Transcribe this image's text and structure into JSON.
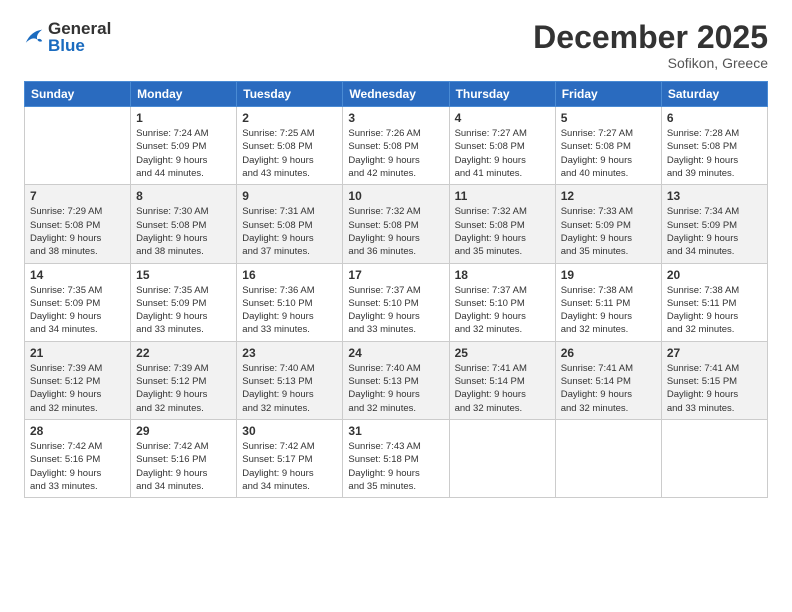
{
  "header": {
    "logo": {
      "general": "General",
      "blue": "Blue"
    },
    "title": "December 2025",
    "subtitle": "Sofikon, Greece"
  },
  "weekdays": [
    "Sunday",
    "Monday",
    "Tuesday",
    "Wednesday",
    "Thursday",
    "Friday",
    "Saturday"
  ],
  "weeks": [
    {
      "alt": false,
      "days": [
        {
          "num": "",
          "info": ""
        },
        {
          "num": "1",
          "info": "Sunrise: 7:24 AM\nSunset: 5:09 PM\nDaylight: 9 hours\nand 44 minutes."
        },
        {
          "num": "2",
          "info": "Sunrise: 7:25 AM\nSunset: 5:08 PM\nDaylight: 9 hours\nand 43 minutes."
        },
        {
          "num": "3",
          "info": "Sunrise: 7:26 AM\nSunset: 5:08 PM\nDaylight: 9 hours\nand 42 minutes."
        },
        {
          "num": "4",
          "info": "Sunrise: 7:27 AM\nSunset: 5:08 PM\nDaylight: 9 hours\nand 41 minutes."
        },
        {
          "num": "5",
          "info": "Sunrise: 7:27 AM\nSunset: 5:08 PM\nDaylight: 9 hours\nand 40 minutes."
        },
        {
          "num": "6",
          "info": "Sunrise: 7:28 AM\nSunset: 5:08 PM\nDaylight: 9 hours\nand 39 minutes."
        }
      ]
    },
    {
      "alt": true,
      "days": [
        {
          "num": "7",
          "info": "Sunrise: 7:29 AM\nSunset: 5:08 PM\nDaylight: 9 hours\nand 38 minutes."
        },
        {
          "num": "8",
          "info": "Sunrise: 7:30 AM\nSunset: 5:08 PM\nDaylight: 9 hours\nand 38 minutes."
        },
        {
          "num": "9",
          "info": "Sunrise: 7:31 AM\nSunset: 5:08 PM\nDaylight: 9 hours\nand 37 minutes."
        },
        {
          "num": "10",
          "info": "Sunrise: 7:32 AM\nSunset: 5:08 PM\nDaylight: 9 hours\nand 36 minutes."
        },
        {
          "num": "11",
          "info": "Sunrise: 7:32 AM\nSunset: 5:08 PM\nDaylight: 9 hours\nand 35 minutes."
        },
        {
          "num": "12",
          "info": "Sunrise: 7:33 AM\nSunset: 5:09 PM\nDaylight: 9 hours\nand 35 minutes."
        },
        {
          "num": "13",
          "info": "Sunrise: 7:34 AM\nSunset: 5:09 PM\nDaylight: 9 hours\nand 34 minutes."
        }
      ]
    },
    {
      "alt": false,
      "days": [
        {
          "num": "14",
          "info": "Sunrise: 7:35 AM\nSunset: 5:09 PM\nDaylight: 9 hours\nand 34 minutes."
        },
        {
          "num": "15",
          "info": "Sunrise: 7:35 AM\nSunset: 5:09 PM\nDaylight: 9 hours\nand 33 minutes."
        },
        {
          "num": "16",
          "info": "Sunrise: 7:36 AM\nSunset: 5:10 PM\nDaylight: 9 hours\nand 33 minutes."
        },
        {
          "num": "17",
          "info": "Sunrise: 7:37 AM\nSunset: 5:10 PM\nDaylight: 9 hours\nand 33 minutes."
        },
        {
          "num": "18",
          "info": "Sunrise: 7:37 AM\nSunset: 5:10 PM\nDaylight: 9 hours\nand 32 minutes."
        },
        {
          "num": "19",
          "info": "Sunrise: 7:38 AM\nSunset: 5:11 PM\nDaylight: 9 hours\nand 32 minutes."
        },
        {
          "num": "20",
          "info": "Sunrise: 7:38 AM\nSunset: 5:11 PM\nDaylight: 9 hours\nand 32 minutes."
        }
      ]
    },
    {
      "alt": true,
      "days": [
        {
          "num": "21",
          "info": "Sunrise: 7:39 AM\nSunset: 5:12 PM\nDaylight: 9 hours\nand 32 minutes."
        },
        {
          "num": "22",
          "info": "Sunrise: 7:39 AM\nSunset: 5:12 PM\nDaylight: 9 hours\nand 32 minutes."
        },
        {
          "num": "23",
          "info": "Sunrise: 7:40 AM\nSunset: 5:13 PM\nDaylight: 9 hours\nand 32 minutes."
        },
        {
          "num": "24",
          "info": "Sunrise: 7:40 AM\nSunset: 5:13 PM\nDaylight: 9 hours\nand 32 minutes."
        },
        {
          "num": "25",
          "info": "Sunrise: 7:41 AM\nSunset: 5:14 PM\nDaylight: 9 hours\nand 32 minutes."
        },
        {
          "num": "26",
          "info": "Sunrise: 7:41 AM\nSunset: 5:14 PM\nDaylight: 9 hours\nand 32 minutes."
        },
        {
          "num": "27",
          "info": "Sunrise: 7:41 AM\nSunset: 5:15 PM\nDaylight: 9 hours\nand 33 minutes."
        }
      ]
    },
    {
      "alt": false,
      "days": [
        {
          "num": "28",
          "info": "Sunrise: 7:42 AM\nSunset: 5:16 PM\nDaylight: 9 hours\nand 33 minutes."
        },
        {
          "num": "29",
          "info": "Sunrise: 7:42 AM\nSunset: 5:16 PM\nDaylight: 9 hours\nand 34 minutes."
        },
        {
          "num": "30",
          "info": "Sunrise: 7:42 AM\nSunset: 5:17 PM\nDaylight: 9 hours\nand 34 minutes."
        },
        {
          "num": "31",
          "info": "Sunrise: 7:43 AM\nSunset: 5:18 PM\nDaylight: 9 hours\nand 35 minutes."
        },
        {
          "num": "",
          "info": ""
        },
        {
          "num": "",
          "info": ""
        },
        {
          "num": "",
          "info": ""
        }
      ]
    }
  ]
}
